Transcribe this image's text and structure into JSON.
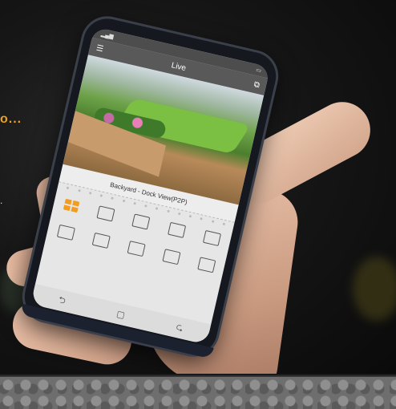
{
  "overlay": {
    "tagline": "o...",
    "tagline_small": "."
  },
  "phone": {
    "app_title": "Live",
    "camera_caption": "Backyard - Dock View(P2P)",
    "toolbar_row1": [
      "layout-grid-icon",
      "playback-icon",
      "ptz-icon",
      "multi-view-icon",
      "channel-icon"
    ],
    "toolbar_row2": [
      "snapshot-icon",
      "record-icon",
      "quality-icon",
      "fullscreen-icon",
      "alarm-icon"
    ],
    "nav": [
      "back-icon",
      "home-icon",
      "recent-icon"
    ]
  },
  "colors": {
    "accent": "#f39c1e",
    "tagline": "#e8a21c"
  }
}
